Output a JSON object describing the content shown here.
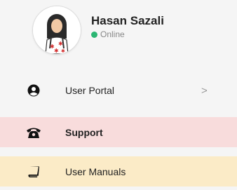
{
  "profile": {
    "name": "Hasan Sazali",
    "status": "Online",
    "status_color": "#2bb673"
  },
  "menu": {
    "items": [
      {
        "label": "User Portal",
        "icon": "user-circle-icon",
        "has_chevron": true,
        "chevron": ">",
        "highlight": null
      },
      {
        "label": "Support",
        "icon": "telephone-icon",
        "has_chevron": false,
        "highlight": "#f8dcdc",
        "bold": true
      },
      {
        "label": "User Manuals",
        "icon": "book-icon",
        "has_chevron": false,
        "highlight": "#fbebc7"
      }
    ]
  }
}
